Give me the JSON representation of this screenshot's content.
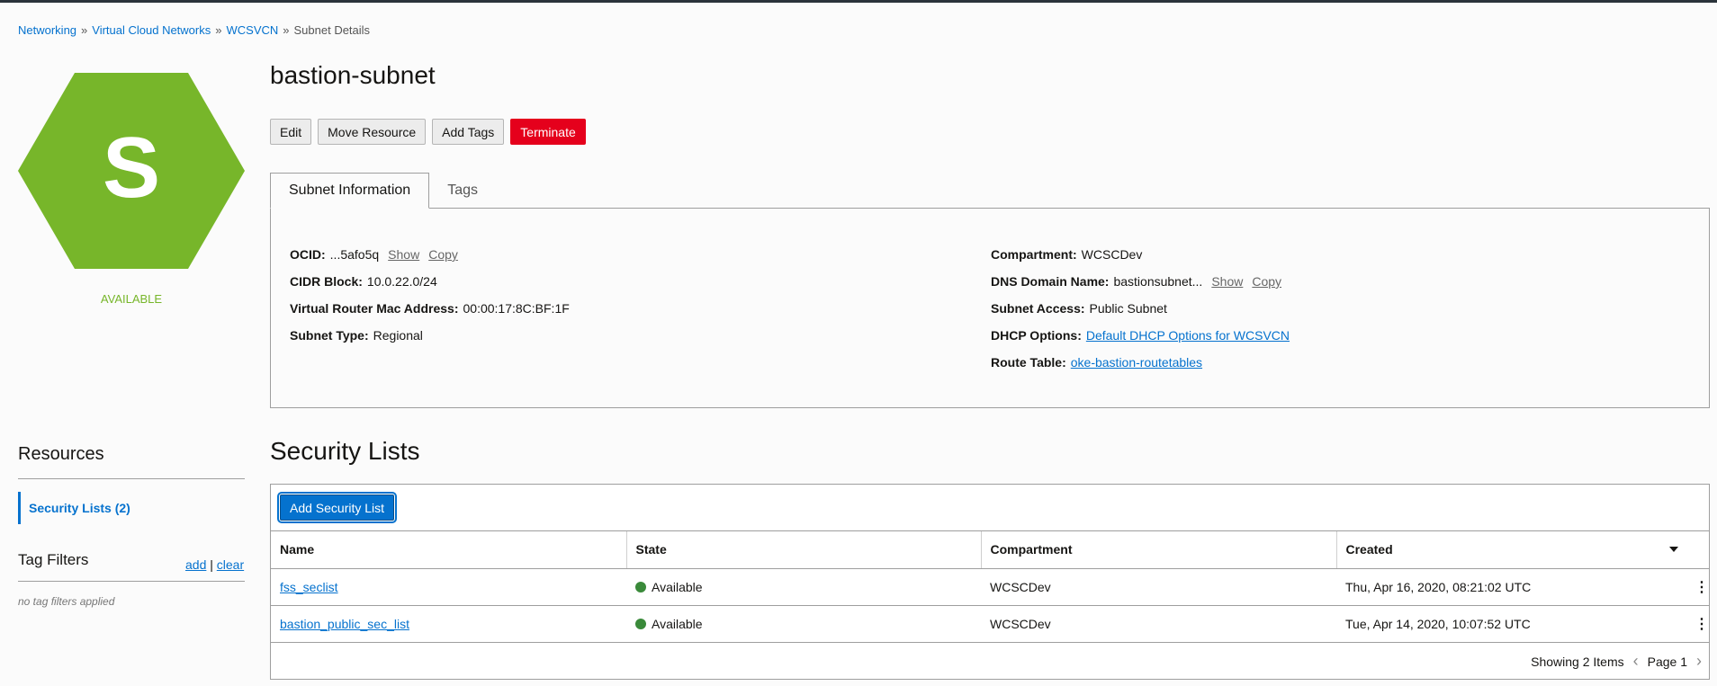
{
  "breadcrumb": {
    "items": [
      "Networking",
      "Virtual Cloud Networks",
      "WCSVCN"
    ],
    "current": "Subnet Details",
    "separator": "»"
  },
  "resource": {
    "icon_letter": "S",
    "status": "AVAILABLE",
    "title": "bastion-subnet",
    "colors": {
      "hex": "#77b62a",
      "status": "#77b62a"
    }
  },
  "actions": {
    "edit": "Edit",
    "move": "Move Resource",
    "add_tags": "Add Tags",
    "terminate": "Terminate"
  },
  "tabs": [
    "Subnet Information",
    "Tags"
  ],
  "info": {
    "ocid_label": "OCID:",
    "ocid_value": "...5afo5q",
    "show": "Show",
    "copy": "Copy",
    "cidr_label": "CIDR Block:",
    "cidr_value": "10.0.22.0/24",
    "vrmac_label": "Virtual Router Mac Address:",
    "vrmac_value": "00:00:17:8C:BF:1F",
    "subnet_type_label": "Subnet Type:",
    "subnet_type_value": "Regional",
    "compartment_label": "Compartment:",
    "compartment_value": "WCSCDev",
    "dns_label": "DNS Domain Name:",
    "dns_value": "bastionsubnet...",
    "access_label": "Subnet Access:",
    "access_value": "Public Subnet",
    "dhcp_label": "DHCP Options:",
    "dhcp_value": "Default DHCP Options for WCSVCN",
    "route_label": "Route Table:",
    "route_value": "oke-bastion-routetables"
  },
  "sidebar": {
    "resources_title": "Resources",
    "security_lists_item": "Security Lists (2)",
    "tag_filters_title": "Tag Filters",
    "add": "add",
    "divider": "|",
    "clear": "clear",
    "no_filters": "no tag filters applied"
  },
  "security_lists": {
    "title": "Security Lists",
    "add_button": "Add Security List",
    "columns": [
      "Name",
      "State",
      "Compartment",
      "Created"
    ],
    "rows": [
      {
        "name": "fss_seclist",
        "state": "Available",
        "compartment": "WCSCDev",
        "created": "Thu, Apr 16, 2020, 08:21:02 UTC"
      },
      {
        "name": "bastion_public_sec_list",
        "state": "Available",
        "compartment": "WCSCDev",
        "created": "Tue, Apr 14, 2020, 10:07:52 UTC"
      }
    ],
    "footer_count": "Showing 2 Items",
    "page_label": "Page 1"
  }
}
